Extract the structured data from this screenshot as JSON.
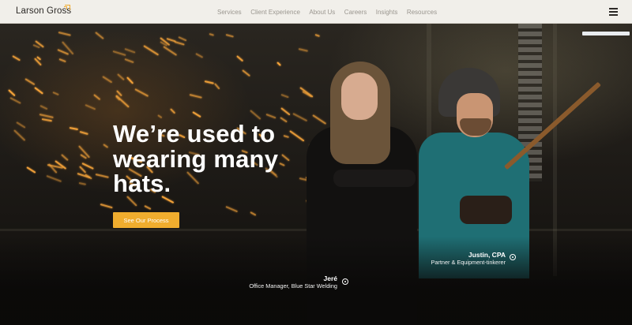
{
  "header": {
    "logo": "Larson Gross",
    "nav": [
      "Services",
      "Client Experience",
      "About Us",
      "Careers",
      "Insights",
      "Resources"
    ],
    "menu_icon": "hamburger-menu-icon"
  },
  "hero": {
    "headline": "We’re used to wearing many hats.",
    "cta_label": "See Our Process",
    "people": [
      {
        "name": "Justin, CPA",
        "role": "Partner & Equipment-tinkerer"
      },
      {
        "name": "Jeré",
        "role": "Office Manager, Blue Star Welding"
      }
    ]
  },
  "colors": {
    "accent": "#f0ad2e",
    "header_bg": "#f1efea",
    "nav_text": "#9a968f"
  }
}
